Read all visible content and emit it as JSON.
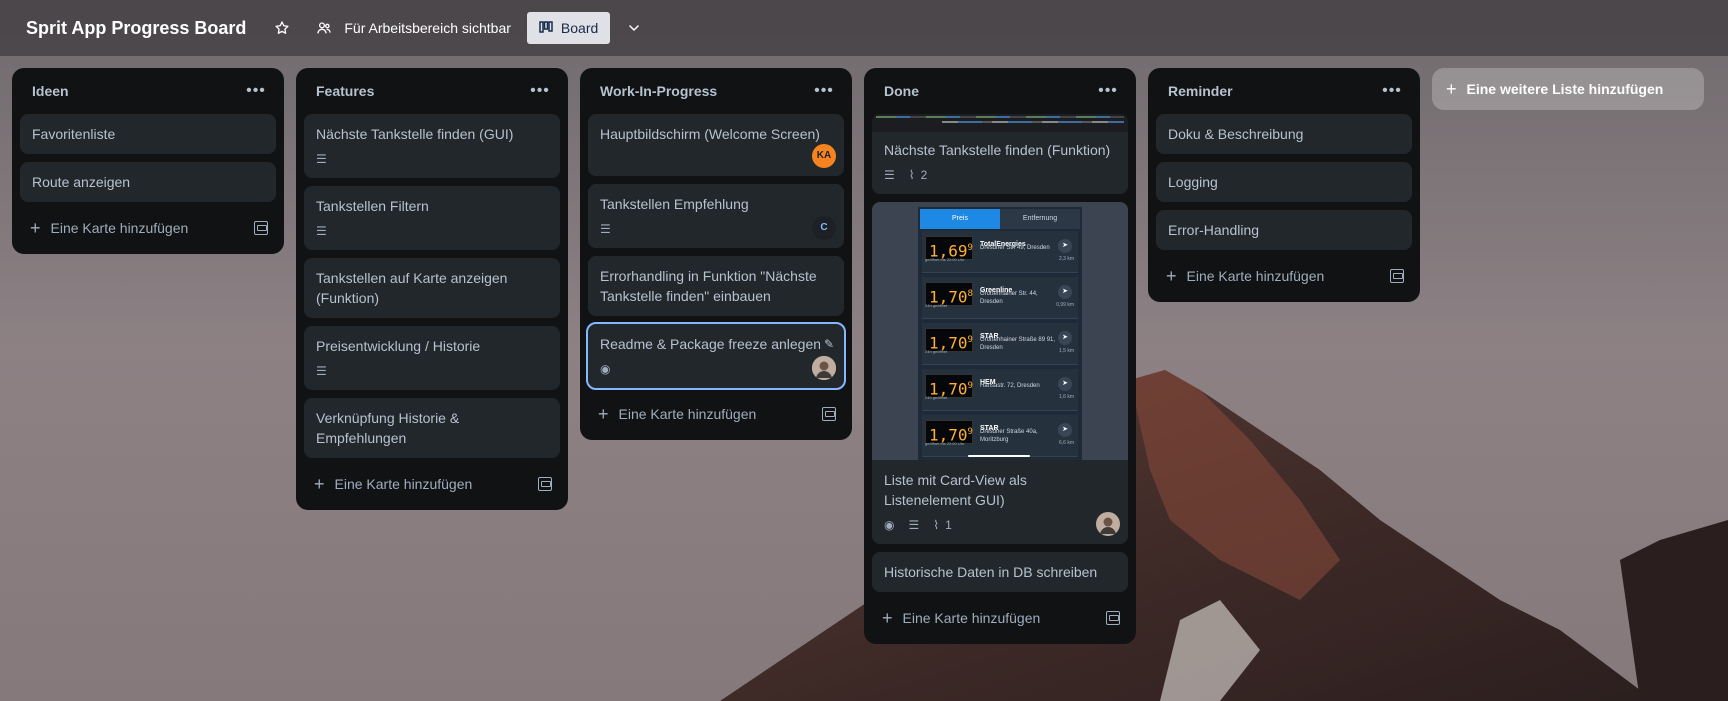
{
  "header": {
    "title": "Sprit App Progress Board",
    "visibility_label": "Für Arbeitsbereich sichtbar",
    "view_label": "Board"
  },
  "add_card_label": "Eine Karte hinzufügen",
  "add_list_label": "Eine weitere Liste hinzufügen",
  "lists": [
    {
      "title": "Ideen",
      "cards": [
        {
          "title": "Favoritenliste"
        },
        {
          "title": "Route anzeigen"
        }
      ]
    },
    {
      "title": "Features",
      "cards": [
        {
          "title": "Nächste Tankstelle finden (GUI)",
          "has_description": true
        },
        {
          "title": "Tankstellen Filtern",
          "has_description": true
        },
        {
          "title": "Tankstellen auf Karte anzeigen (Funktion)"
        },
        {
          "title": "Preisentwicklung / Historie",
          "has_description": true
        },
        {
          "title": "Verknüpfung Historie & Empfehlungen"
        }
      ]
    },
    {
      "title": "Work-In-Progress",
      "cards": [
        {
          "title": "Hauptbildschirm (Welcome Screen)",
          "member": "KA",
          "member_color": "#f5831f"
        },
        {
          "title": "Tankstellen Empfehlung",
          "has_description": true,
          "member": "C",
          "member_color": "#1d2125"
        },
        {
          "title": "Errorhandling in Funktion \"Nächste Tankstelle finden\" einbauen"
        },
        {
          "title": "Readme & Package freeze anlegen",
          "watching": true,
          "member": "",
          "member_color": "#c9b8a8",
          "selected": true
        }
      ]
    },
    {
      "title": "Done",
      "cards": [
        {
          "title": "Nächste Tankstelle finden (Funktion)",
          "has_description": true,
          "attachments": "2",
          "cover": "code"
        },
        {
          "title": "Liste mit Card-View als Listenelement GUI)",
          "watching": true,
          "has_description": true,
          "attachments": "1",
          "member": "",
          "cover": "screenshot"
        },
        {
          "title": "Historische Daten in DB schreiben"
        }
      ]
    },
    {
      "title": "Reminder",
      "cards": [
        {
          "title": "Doku & Beschreibung"
        },
        {
          "title": "Logging"
        },
        {
          "title": "Error-Handling"
        }
      ]
    }
  ],
  "screenshot_cover": {
    "tabs": [
      "Preis",
      "Entfernung"
    ],
    "rows": [
      {
        "price": "1,69",
        "price_sup": "9",
        "name": "TotalEnergies",
        "address": "Dresdner Str. 49, Dresden",
        "distance": "2,3 km",
        "updated": "geöffnet bis 22:00 Uhr"
      },
      {
        "price": "1,70",
        "price_sup": "8",
        "name": "Greenline",
        "address": "Großenhainer Str. 44, Dresden",
        "distance": "0,99 km",
        "updated": "24h geöffnet"
      },
      {
        "price": "1,70",
        "price_sup": "9",
        "name": "STAR",
        "address": "Großenhainer Straße 89 91, Dresden",
        "distance": "1,5 km",
        "updated": "24h geöffnet"
      },
      {
        "price": "1,70",
        "price_sup": "9",
        "name": "HEM",
        "address": "Hansastr. 72, Dresden",
        "distance": "1,6 km",
        "updated": "24h geöffnet"
      },
      {
        "price": "1,70",
        "price_sup": "9",
        "name": "STAR",
        "address": "Dresdner Straße 40a, Moritzburg",
        "distance": "6,6 km",
        "updated": "geöffnet bis 22:00 Uhr"
      }
    ]
  },
  "icons": {
    "star": "star-icon",
    "visibility": "people-icon",
    "board": "board-icon",
    "chevron": "chevron-down-icon",
    "menu": "ellipsis-icon",
    "plus": "plus-icon",
    "template": "template-icon",
    "description": "description-icon",
    "eye": "eye-icon",
    "paperclip": "paperclip-icon",
    "pencil": "pencil-icon"
  }
}
